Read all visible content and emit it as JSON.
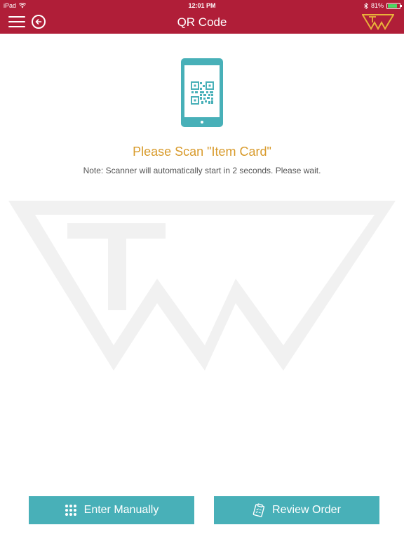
{
  "status_bar": {
    "device": "iPad",
    "time": "12:01 PM",
    "battery_percent": "81%",
    "battery_level": 0.81,
    "icons": [
      "wifi-icon",
      "bluetooth-icon",
      "battery-icon"
    ]
  },
  "navbar": {
    "title": "QR Code",
    "icons": [
      "hamburger-menu-icon",
      "back-arrow-icon",
      "app-logo-icon"
    ]
  },
  "main": {
    "icon": "phone-qr-icon",
    "title": "Please Scan \"Item Card\"",
    "note": "Note: Scanner will automatically start in 2 seconds. Please wait."
  },
  "buttons": {
    "enter_manually": {
      "label": "Enter Manually",
      "icon": "keypad-icon"
    },
    "review_order": {
      "label": "Review Order",
      "icon": "clipboard-icon"
    }
  },
  "colors": {
    "header": "#b01e38",
    "accent_teal": "#48b0b8",
    "title_gold": "#d89a2a",
    "logo_gold": "#e8b23a",
    "watermark": "#f1f1f1"
  }
}
